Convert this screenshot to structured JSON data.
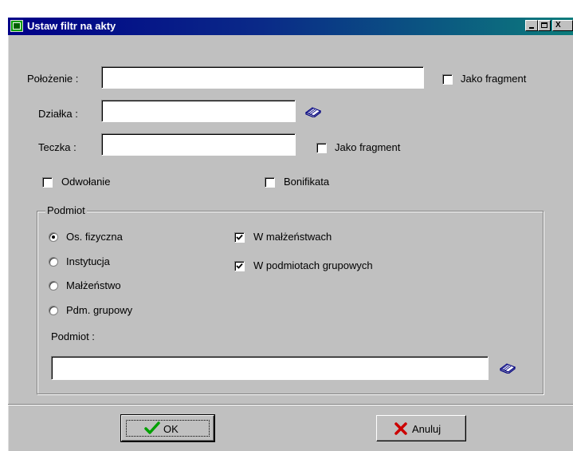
{
  "window": {
    "title": "Ustaw filtr na akty",
    "controls": {
      "minimize": "_",
      "maximize": "□",
      "close": "X"
    }
  },
  "fields": {
    "polozenie": {
      "label": "Położenie :",
      "value": ""
    },
    "dzialka": {
      "label": "Działka :",
      "value": ""
    },
    "teczka": {
      "label": "Teczka :",
      "value": ""
    }
  },
  "checkboxes": {
    "polozenie_fragment": {
      "label": "Jako fragment",
      "checked": false
    },
    "teczka_fragment": {
      "label": "Jako fragment",
      "checked": false
    },
    "odwolanie": {
      "label": "Odwołanie",
      "checked": false
    },
    "bonifikata": {
      "label": "Bonifikata",
      "checked": false
    }
  },
  "podmiot_group": {
    "title": "Podmiot",
    "radios": [
      {
        "label": "Os. fizyczna",
        "selected": true
      },
      {
        "label": "Instytucja",
        "selected": false
      },
      {
        "label": "Małżeństwo",
        "selected": false
      },
      {
        "label": "Pdm. grupowy",
        "selected": false
      }
    ],
    "options": [
      {
        "label": "W małżeństwach",
        "checked": true
      },
      {
        "label": "W podmiotach grupowych",
        "checked": true
      }
    ],
    "podmiot_field": {
      "label": "Podmiot :",
      "value": ""
    }
  },
  "buttons": {
    "ok": "OK",
    "cancel": "Anuluj"
  },
  "icons": {
    "lookup": "book-lookup-icon",
    "ok": "green-check-icon",
    "cancel": "red-x-icon"
  },
  "colors": {
    "titlebar_start": "#000088",
    "titlebar_end": "#0c7c7c",
    "face": "#c0c0c0",
    "ok_check": "#00a000",
    "cancel_x": "#cc0000"
  }
}
